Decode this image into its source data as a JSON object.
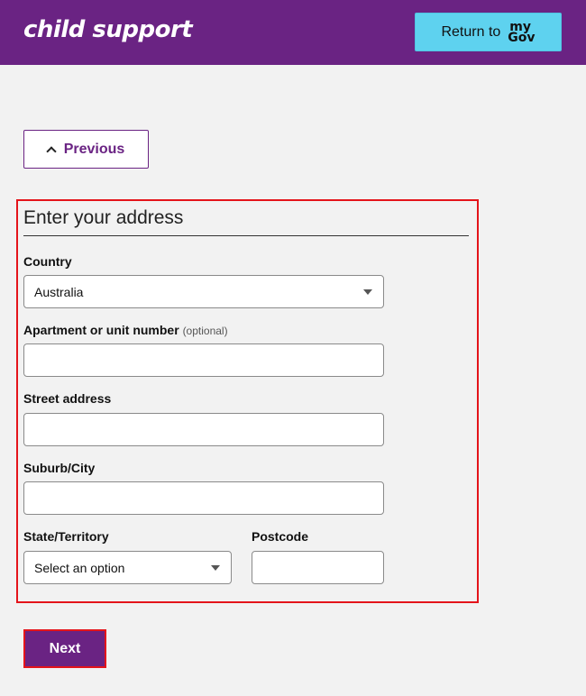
{
  "header": {
    "brand": "child support",
    "return_label": "Return to",
    "mygov_top": "my",
    "mygov_bottom": "Gov"
  },
  "nav": {
    "previous_label": "Previous"
  },
  "form": {
    "title": "Enter your address",
    "country": {
      "label": "Country",
      "value": "Australia"
    },
    "apartment": {
      "label": "Apartment or unit number",
      "optional": "(optional)",
      "value": ""
    },
    "street": {
      "label": "Street address",
      "value": ""
    },
    "suburb": {
      "label": "Suburb/City",
      "value": ""
    },
    "state": {
      "label": "State/Territory",
      "value": "Select an option"
    },
    "postcode": {
      "label": "Postcode",
      "value": ""
    }
  },
  "actions": {
    "next_label": "Next"
  },
  "colors": {
    "brand_purple": "#6a2383",
    "mygov_cyan": "#5ed2ef",
    "highlight_red": "#e4141b",
    "page_bg": "#f2f2f2"
  }
}
